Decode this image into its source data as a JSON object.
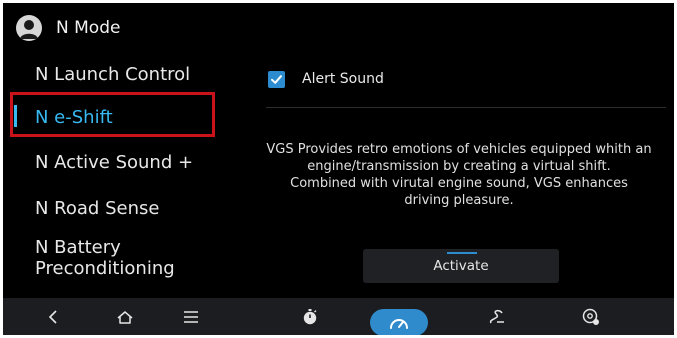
{
  "header": {
    "title": "N Mode",
    "icon": "person-icon"
  },
  "sidebar": {
    "items": [
      {
        "label": "N Launch Control",
        "active": false
      },
      {
        "label": "N e-Shift",
        "active": true
      },
      {
        "label": "N Active Sound +",
        "active": false
      },
      {
        "label": "N Road Sense",
        "active": false
      },
      {
        "label": "N Battery",
        "label2": "Preconditioning",
        "active": false
      }
    ]
  },
  "main": {
    "alert_sound": {
      "label": "Alert Sound",
      "checked": true
    },
    "description": [
      "VGS Provides retro emotions of vehicles equipped whith an",
      "engine/transmission by creating a virtual shift.",
      "Combined with virutal engine sound, VGS enhances",
      "driving pleasure."
    ],
    "activate_button": "Activate"
  },
  "bottom_bar": {
    "icons": [
      "back-chevron-icon",
      "home-icon",
      "menu-icon",
      "stopwatch-icon",
      "gauge-icon",
      "route-icon",
      "settings-icon"
    ],
    "active": "gauge-icon"
  },
  "colors": {
    "accent": "#37b9f1",
    "highlight_border": "#c8131b",
    "checkbox": "#2c8ccf",
    "background": "#000000",
    "bottom_bar": "#1b1d21"
  }
}
